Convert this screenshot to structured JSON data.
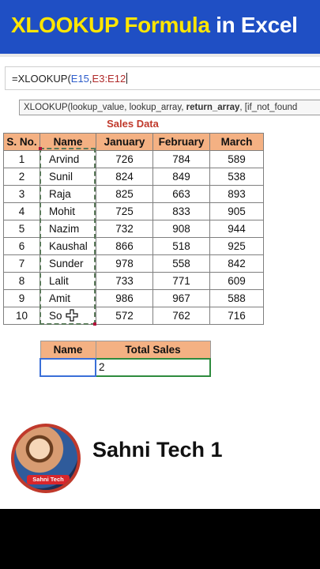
{
  "banner": {
    "title_part1": "XLOOKUP Formula",
    "title_part2": "in Excel",
    "bg_color": "#1f4fc4",
    "accent_color": "#ffe600"
  },
  "formula_bar": {
    "prefix": "=XLOOKUP(",
    "ref1": "E15",
    "sep": ",",
    "ref2": "E3:E12"
  },
  "tooltip": {
    "part1": "XLOOKUP(lookup_value, lookup_array, ",
    "bold": "return_array",
    "part2": ", [if_not_found"
  },
  "table": {
    "title": "Sales Data",
    "columns": [
      "S. No.",
      "Name",
      "January",
      "February",
      "March"
    ],
    "rows": [
      [
        "1",
        "Arvind",
        "726",
        "784",
        "589"
      ],
      [
        "2",
        "Sunil",
        "824",
        "849",
        "538"
      ],
      [
        "3",
        "Raja",
        "825",
        "663",
        "893"
      ],
      [
        "4",
        "Mohit",
        "725",
        "833",
        "905"
      ],
      [
        "5",
        "Nazim",
        "732",
        "908",
        "944"
      ],
      [
        "6",
        "Kaushal",
        "866",
        "518",
        "925"
      ],
      [
        "7",
        "Sunder",
        "978",
        "558",
        "842"
      ],
      [
        "8",
        "Lalit",
        "733",
        "771",
        "609"
      ],
      [
        "9",
        "Amit",
        "986",
        "967",
        "588"
      ],
      [
        "10",
        "So",
        "572",
        "762",
        "716"
      ]
    ],
    "header_color": "#f4b183"
  },
  "lookup": {
    "name_header": "Name",
    "total_header": "Total Sales",
    "name_value": "",
    "total_value": "2"
  },
  "footer": {
    "channel_name": "Sahni Tech 1",
    "avatar_badge": "Sahni Tech"
  }
}
